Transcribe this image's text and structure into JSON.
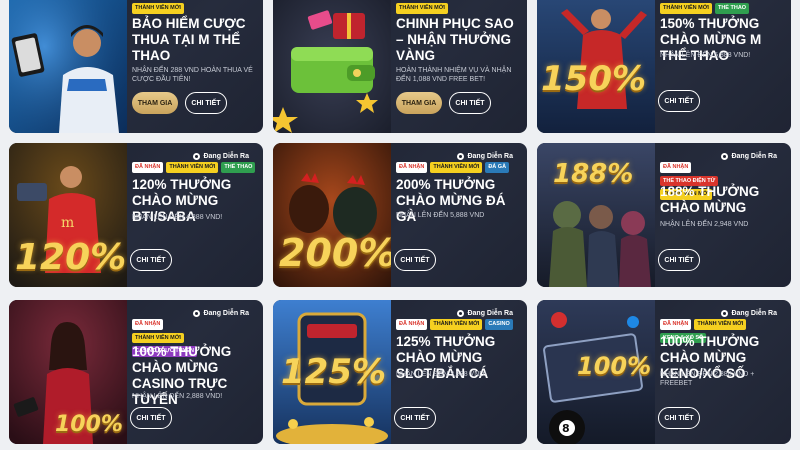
{
  "status_label": "Đang Diễn Ra",
  "join_label": "THAM GIA",
  "detail_label": "CHI TIẾT",
  "cards": [
    {
      "tags": [
        {
          "text": "THÀNH VIÊN MỚI",
          "color": "yellow"
        }
      ],
      "title": "BẢO HIỂM CƯỢC THUA TẠI M THỂ THAO",
      "sub": "NHẬN ĐẾN 288 VND HOÀN THUA VÉ CƯỢC ĐẦU TIÊN!",
      "art": "soccer-player"
    },
    {
      "tags": [
        {
          "text": "THÀNH VIÊN MỚI",
          "color": "yellow"
        }
      ],
      "title": "CHINH PHỤC SAO – NHẬN THƯỞNG VÀNG",
      "sub": "HOÀN THÀNH NHIỆM VỤ VÀ NHẬN ĐẾN 1,088 VND FREE BET!",
      "art": "wallet"
    },
    {
      "tags": [
        {
          "text": "THÀNH VIÊN MỚI",
          "color": "yellow"
        },
        {
          "text": "THỂ THAO",
          "color": "green"
        }
      ],
      "title": "150% THƯỞNG CHÀO MỪNG M THỂ THAO",
      "sub": "NHẬN LÊN ĐẾN 5,888 VND!",
      "art": "150%"
    },
    {
      "tags": [
        {
          "text": "ĐÃ NHẬN",
          "color": "white"
        },
        {
          "text": "THÀNH VIÊN MỚI",
          "color": "yellow"
        },
        {
          "text": "THỂ THAO",
          "color": "green"
        }
      ],
      "title": "120% THƯỞNG CHÀO MỪNG BTI/SABA",
      "sub": "NHẬN LÊN ĐẾN 4,888 VND!",
      "art": "120%"
    },
    {
      "tags": [
        {
          "text": "ĐÃ NHẬN",
          "color": "white"
        },
        {
          "text": "THÀNH VIÊN MỚI",
          "color": "yellow"
        },
        {
          "text": "ĐÁ GÀ",
          "color": "blue"
        }
      ],
      "title": "200% THƯỞNG CHÀO MỪNG ĐÁ GÀ",
      "sub": "NHẬN LÊN ĐẾN 5,888 VND",
      "art": "200%"
    },
    {
      "tags": [
        {
          "text": "ĐÃ NHẬN",
          "color": "white"
        },
        {
          "text": "THỂ THAO ĐIỆN TỬ",
          "color": "red"
        },
        {
          "text": "THÀNH VIÊN MỚI",
          "color": "yellow"
        }
      ],
      "title": "188% THƯỞNG CHÀO MỪNG",
      "sub": "NHẬN LÊN ĐẾN 2,948 VND",
      "art": "188%"
    },
    {
      "tags": [
        {
          "text": "ĐÃ NHẬN",
          "color": "white"
        },
        {
          "text": "THÀNH VIÊN MỚI",
          "color": "yellow"
        },
        {
          "text": "CASINO TRỰC TUYẾN",
          "color": "purple"
        }
      ],
      "title": "100% THƯỞNG CHÀO MỪNG CASINO TRỰC TUYẾN",
      "sub": "NHẬN LÊN ĐẾN 2,888 VND!",
      "art": "100%"
    },
    {
      "tags": [
        {
          "text": "ĐÃ NHẬN",
          "color": "white"
        },
        {
          "text": "THÀNH VIÊN MỚI",
          "color": "yellow"
        },
        {
          "text": "CASINO",
          "color": "blue"
        }
      ],
      "title": "125% THƯỞNG CHÀO MỪNG SLOT/BẮN CÁ",
      "sub": "NHẬN LÊN ĐẾN 3,888 VND!",
      "art": "125%"
    },
    {
      "tags": [
        {
          "text": "ĐÃ NHẬN",
          "color": "white"
        },
        {
          "text": "THÀNH VIÊN MỚI",
          "color": "yellow"
        },
        {
          "text": "KENO & XỔ SỐ",
          "color": "green"
        }
      ],
      "title": "100% THƯỞNG CHÀO MỪNG KENO/XỔ SỐ",
      "sub": "NHẬN LÊN ĐẾN 2,888 VND + FREEBET",
      "art": "100%"
    }
  ]
}
